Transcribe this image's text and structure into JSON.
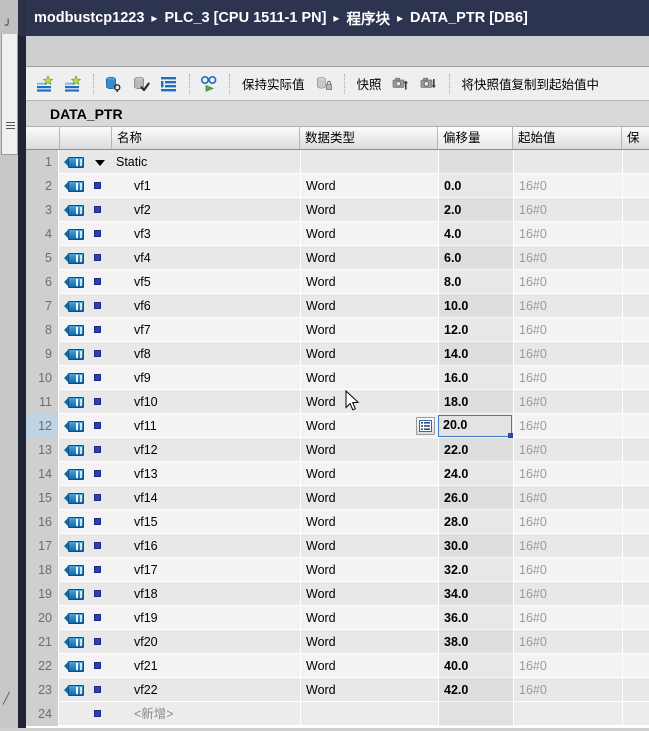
{
  "breadcrumb": {
    "separator": "▸",
    "segments": [
      "modbustcp1223",
      "PLC_3 [CPU 1511-1 PN]",
      "程序块",
      "DATA_PTR [DB6]"
    ]
  },
  "toolbar": {
    "buttons": [
      {
        "name": "insert-row-above-icon",
        "label": ""
      },
      {
        "name": "insert-row-below-icon",
        "label": ""
      },
      {
        "name": "download-to-device-icon",
        "label": ""
      },
      {
        "name": "monitor-write-icon",
        "label": ""
      },
      {
        "name": "expand-all-icon",
        "label": ""
      },
      {
        "name": "monitor-all-icon",
        "label": ""
      }
    ],
    "keep_actual_values": "保持实际值",
    "lock_icon": "lock-icon",
    "snapshot": "快照",
    "snapshot_upload_icon": "snapshot-upload-icon",
    "snapshot_download_icon": "snapshot-download-icon",
    "copy_snapshot_to_start": "将快照值复制到起始值中"
  },
  "db": {
    "title": "DATA_PTR"
  },
  "table": {
    "columns": [
      {
        "key": "num",
        "label": ""
      },
      {
        "key": "tag",
        "label": ""
      },
      {
        "key": "dot",
        "label": ""
      },
      {
        "key": "name",
        "label": "名称"
      },
      {
        "key": "type",
        "label": "数据类型"
      },
      {
        "key": "off",
        "label": "偏移量"
      },
      {
        "key": "start",
        "label": "起始值"
      },
      {
        "key": "ret",
        "label": "保"
      }
    ],
    "selected_row": 12,
    "selected_cell_column": "off",
    "selected_cell_value": "20.0",
    "rows": [
      {
        "num": "1",
        "tag": true,
        "marker": "triangle",
        "name": "Static",
        "type": "",
        "off": "",
        "start": ""
      },
      {
        "num": "2",
        "tag": true,
        "marker": "square",
        "name": "vf1",
        "type": "Word",
        "off": "0.0",
        "start": "16#0"
      },
      {
        "num": "3",
        "tag": true,
        "marker": "square",
        "name": "vf2",
        "type": "Word",
        "off": "2.0",
        "start": "16#0"
      },
      {
        "num": "4",
        "tag": true,
        "marker": "square",
        "name": "vf3",
        "type": "Word",
        "off": "4.0",
        "start": "16#0"
      },
      {
        "num": "5",
        "tag": true,
        "marker": "square",
        "name": "vf4",
        "type": "Word",
        "off": "6.0",
        "start": "16#0"
      },
      {
        "num": "6",
        "tag": true,
        "marker": "square",
        "name": "vf5",
        "type": "Word",
        "off": "8.0",
        "start": "16#0"
      },
      {
        "num": "7",
        "tag": true,
        "marker": "square",
        "name": "vf6",
        "type": "Word",
        "off": "10.0",
        "start": "16#0"
      },
      {
        "num": "8",
        "tag": true,
        "marker": "square",
        "name": "vf7",
        "type": "Word",
        "off": "12.0",
        "start": "16#0"
      },
      {
        "num": "9",
        "tag": true,
        "marker": "square",
        "name": "vf8",
        "type": "Word",
        "off": "14.0",
        "start": "16#0"
      },
      {
        "num": "10",
        "tag": true,
        "marker": "square",
        "name": "vf9",
        "type": "Word",
        "off": "16.0",
        "start": "16#0"
      },
      {
        "num": "11",
        "tag": true,
        "marker": "square",
        "name": "vf10",
        "type": "Word",
        "off": "18.0",
        "start": "16#0"
      },
      {
        "num": "12",
        "tag": true,
        "marker": "square",
        "name": "vf11",
        "type": "Word",
        "off": "20.0",
        "start": "16#0"
      },
      {
        "num": "13",
        "tag": true,
        "marker": "square",
        "name": "vf12",
        "type": "Word",
        "off": "22.0",
        "start": "16#0"
      },
      {
        "num": "14",
        "tag": true,
        "marker": "square",
        "name": "vf13",
        "type": "Word",
        "off": "24.0",
        "start": "16#0"
      },
      {
        "num": "15",
        "tag": true,
        "marker": "square",
        "name": "vf14",
        "type": "Word",
        "off": "26.0",
        "start": "16#0"
      },
      {
        "num": "16",
        "tag": true,
        "marker": "square",
        "name": "vf15",
        "type": "Word",
        "off": "28.0",
        "start": "16#0"
      },
      {
        "num": "17",
        "tag": true,
        "marker": "square",
        "name": "vf16",
        "type": "Word",
        "off": "30.0",
        "start": "16#0"
      },
      {
        "num": "18",
        "tag": true,
        "marker": "square",
        "name": "vf17",
        "type": "Word",
        "off": "32.0",
        "start": "16#0"
      },
      {
        "num": "19",
        "tag": true,
        "marker": "square",
        "name": "vf18",
        "type": "Word",
        "off": "34.0",
        "start": "16#0"
      },
      {
        "num": "20",
        "tag": true,
        "marker": "square",
        "name": "vf19",
        "type": "Word",
        "off": "36.0",
        "start": "16#0"
      },
      {
        "num": "21",
        "tag": true,
        "marker": "square",
        "name": "vf20",
        "type": "Word",
        "off": "38.0",
        "start": "16#0"
      },
      {
        "num": "22",
        "tag": true,
        "marker": "square",
        "name": "vf21",
        "type": "Word",
        "off": "40.0",
        "start": "16#0"
      },
      {
        "num": "23",
        "tag": true,
        "marker": "square",
        "name": "vf22",
        "type": "Word",
        "off": "42.0",
        "start": "16#0"
      },
      {
        "num": "24",
        "tag": false,
        "marker": "square",
        "name": "<新增>",
        "type": "",
        "off": "",
        "start": ""
      }
    ]
  },
  "colors": {
    "breadcrumb_bg": "#2d3450",
    "accent_blue": "#3f79c0",
    "tag_blue": "#1464a8",
    "selection_row": "#bcd4e6"
  }
}
